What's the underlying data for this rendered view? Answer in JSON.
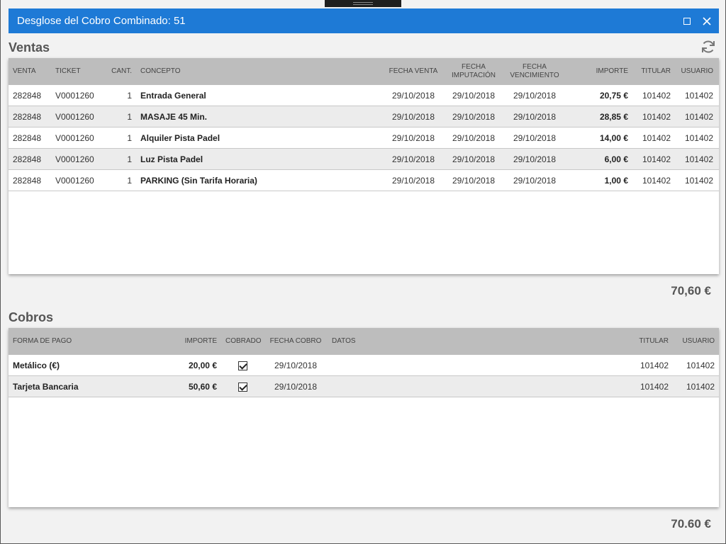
{
  "window": {
    "title": "Desglose del Cobro Combinado: 51",
    "accent": "#1e7ad6",
    "maximize_icon": "maximize-icon",
    "close_icon": "close-icon"
  },
  "ventas": {
    "title": "Ventas",
    "refresh_icon": "refresh-icon",
    "headers": {
      "venta": "VENTA",
      "ticket": "TICKET",
      "cant": "CANT.",
      "concepto": "CONCEPTO",
      "fecha_venta": "FECHA VENTA",
      "fecha_imputacion": "FECHA IMPUTACIÓN",
      "fecha_vencimiento": "FECHA VENCIMIENTO",
      "importe": "IMPORTE",
      "titular": "TITULAR",
      "usuario": "USUARIO"
    },
    "rows": [
      {
        "venta": "282848",
        "ticket": "V0001260",
        "cant": "1",
        "concepto": "Entrada General",
        "fecha_venta": "29/10/2018",
        "fecha_imputacion": "29/10/2018",
        "fecha_vencimiento": "29/10/2018",
        "importe": "20,75 €",
        "titular": "101402",
        "usuario": "101402"
      },
      {
        "venta": "282848",
        "ticket": "V0001260",
        "cant": "1",
        "concepto": "MASAJE 45 Min.",
        "fecha_venta": "29/10/2018",
        "fecha_imputacion": "29/10/2018",
        "fecha_vencimiento": "29/10/2018",
        "importe": "28,85 €",
        "titular": "101402",
        "usuario": "101402"
      },
      {
        "venta": "282848",
        "ticket": "V0001260",
        "cant": "1",
        "concepto": "Alquiler Pista Padel",
        "fecha_venta": "29/10/2018",
        "fecha_imputacion": "29/10/2018",
        "fecha_vencimiento": "29/10/2018",
        "importe": "14,00 €",
        "titular": "101402",
        "usuario": "101402"
      },
      {
        "venta": "282848",
        "ticket": "V0001260",
        "cant": "1",
        "concepto": "Luz Pista Padel",
        "fecha_venta": "29/10/2018",
        "fecha_imputacion": "29/10/2018",
        "fecha_vencimiento": "29/10/2018",
        "importe": "6,00 €",
        "titular": "101402",
        "usuario": "101402"
      },
      {
        "venta": "282848",
        "ticket": "V0001260",
        "cant": "1",
        "concepto": "PARKING (Sin Tarifa Horaria)",
        "fecha_venta": "29/10/2018",
        "fecha_imputacion": "29/10/2018",
        "fecha_vencimiento": "29/10/2018",
        "importe": "1,00 €",
        "titular": "101402",
        "usuario": "101402"
      }
    ],
    "total": "70,60 €"
  },
  "cobros": {
    "title": "Cobros",
    "headers": {
      "forma_pago": "FORMA DE PAGO",
      "importe": "IMPORTE",
      "cobrado": "COBRADO",
      "fecha_cobro": "FECHA COBRO",
      "datos": "DATOS",
      "titular": "TITULAR",
      "usuario": "USUARIO"
    },
    "rows": [
      {
        "forma_pago": "Metálico (€)",
        "importe": "20,00 €",
        "cobrado": true,
        "fecha_cobro": "29/10/2018",
        "datos": "",
        "titular": "101402",
        "usuario": "101402"
      },
      {
        "forma_pago": "Tarjeta Bancaria",
        "importe": "50,60 €",
        "cobrado": true,
        "fecha_cobro": "29/10/2018",
        "datos": "",
        "titular": "101402",
        "usuario": "101402"
      }
    ],
    "total": "70.60 €"
  }
}
